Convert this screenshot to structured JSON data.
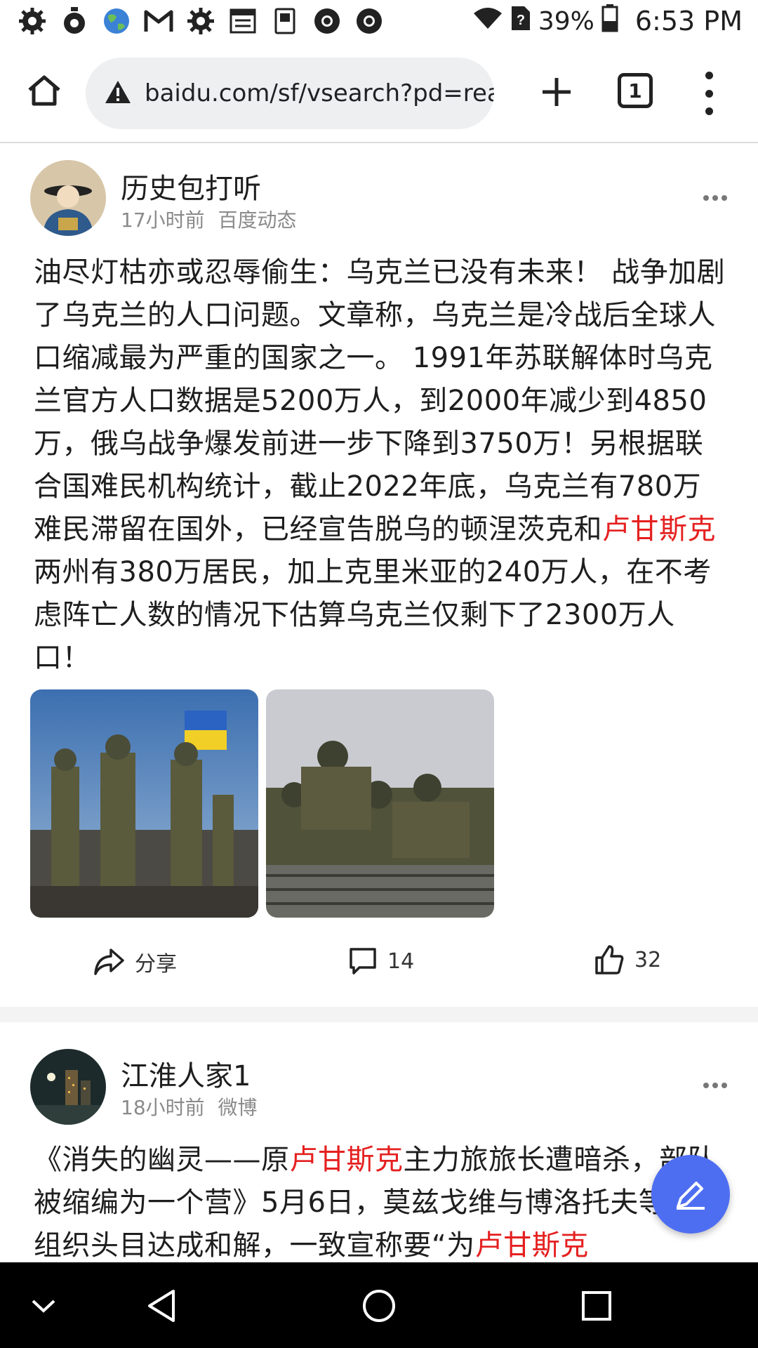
{
  "status_bar": {
    "battery": "39%",
    "time": "6:53 PM",
    "left_icons": [
      "gear-icon",
      "timer-icon",
      "globe-icon",
      "gmail-icon",
      "gear-icon",
      "calendar-icon",
      "dictionary-icon",
      "chrome-icon",
      "chrome-icon"
    ],
    "right_icons": [
      "wifi-icon",
      "no-sim-icon",
      "battery-icon"
    ]
  },
  "browser": {
    "url": "baidu.com/sf/vsearch?pd=rea",
    "tab_count": "1"
  },
  "posts": [
    {
      "author": "历史包打听",
      "time": "17小时前",
      "source": "百度动态",
      "text_parts": {
        "before": "油尽灯枯亦或忍辱偷生：乌克兰已没有未来！ 战争加剧了乌克兰的人口问题。文章称，乌克兰是冷战后全球人口缩减最为严重的国家之一。 1991年苏联解体时乌克兰官方人口数据是5200万人，到2000年减少到4850万，俄乌战争爆发前进一步下降到3750万！另根据联合国难民机构统计，截止2022年底，乌克兰有780万难民滞留在国外，已经宣告脱乌的顿涅茨克和",
        "highlight": "卢甘斯克",
        "after": "两州有380万居民，加上克里米亚的240万人，在不考虑阵亡人数的情况下估算乌克兰仅剩下了2300万人口！"
      },
      "photos": [
        "soldiers-with-flag-photo",
        "soldiers-on-vehicle-photo"
      ],
      "actions": {
        "share": "分享",
        "comments": "14",
        "likes": "32"
      }
    },
    {
      "author": "江淮人家1",
      "time": "18小时前",
      "source": "微博",
      "text_parts": {
        "p1": "《消失的幽灵——原",
        "h1": "卢甘斯克",
        "p2": "主力旅旅长遭暗杀，部队被缩编为一个营》5月6日，莫兹戈维与博洛托夫等民兵组织头目达成和解，一致宣称要“为",
        "h2": "卢甘斯克"
      }
    }
  ],
  "colors": {
    "highlight": "#e52020",
    "fab": "#4e6ef2",
    "url_bar": "#eeeff1"
  }
}
